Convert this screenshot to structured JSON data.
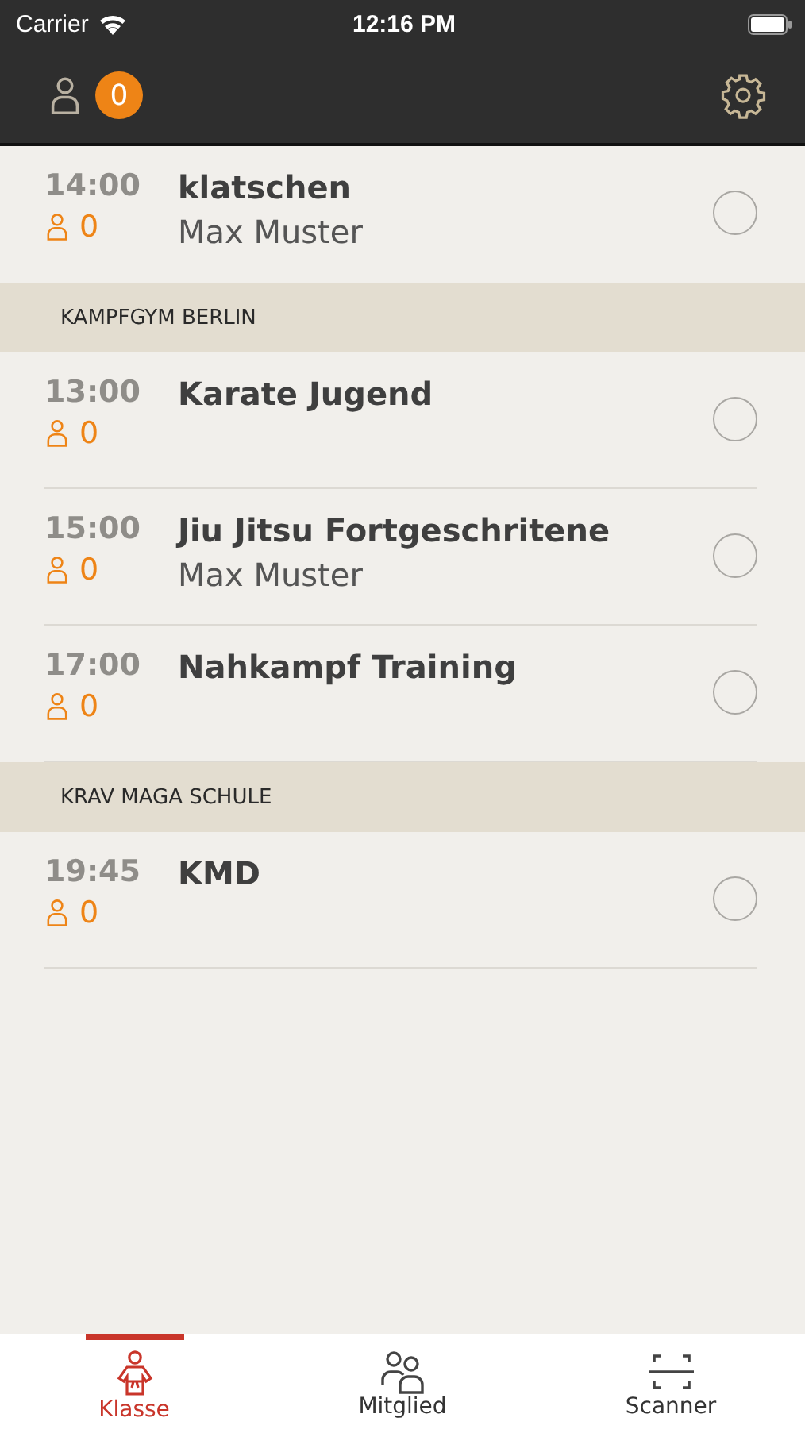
{
  "status_bar": {
    "carrier": "Carrier",
    "time": "12:16 PM"
  },
  "header": {
    "count": "0"
  },
  "groups": [
    {
      "classes": [
        {
          "time": "14:00",
          "count": "0",
          "title": "klatschen",
          "instructor": "Max Muster",
          "checked": false
        }
      ]
    },
    {
      "header": "KAMPFGYM BERLIN",
      "classes": [
        {
          "time": "13:00",
          "count": "0",
          "title": "Karate Jugend",
          "checked": false
        },
        {
          "time": "15:00",
          "count": "0",
          "title": "Jiu Jitsu Fortgeschritene",
          "instructor": "Max Muster",
          "checked": false
        },
        {
          "time": "17:00",
          "count": "0",
          "title": "Nahkampf Training",
          "checked": false
        }
      ]
    },
    {
      "header": "KRAV MAGA SCHULE",
      "classes": [
        {
          "time": "19:45",
          "count": "0",
          "title": "KMD",
          "checked": false
        }
      ]
    }
  ],
  "tabs": [
    {
      "label": "Klasse",
      "kind": "class",
      "selected": true
    },
    {
      "label": "Mitglied",
      "kind": "members",
      "selected": false
    },
    {
      "label": "Scanner",
      "kind": "scanner",
      "selected": false
    }
  ]
}
